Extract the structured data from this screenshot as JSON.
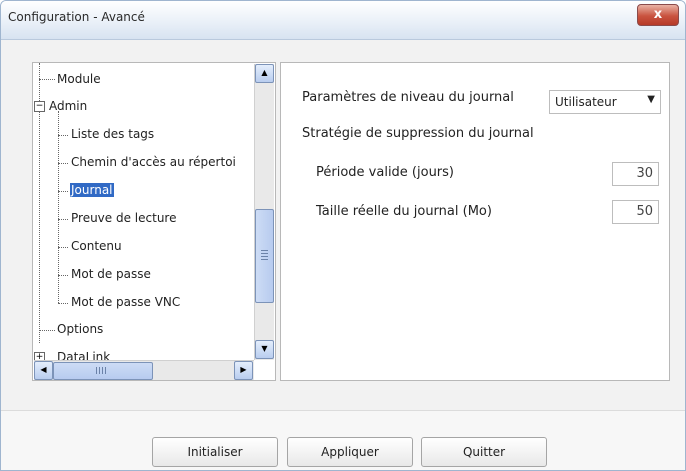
{
  "window": {
    "title": "Configuration - Avancé",
    "close_label": "x"
  },
  "tree": {
    "items": [
      {
        "label": "Module"
      },
      {
        "label": "Admin"
      },
      {
        "label": "Liste des tags"
      },
      {
        "label": "Chemin d'accès au répertoi"
      },
      {
        "label": "Journal"
      },
      {
        "label": "Preuve de lecture"
      },
      {
        "label": "Contenu"
      },
      {
        "label": "Mot de passe"
      },
      {
        "label": "Mot de passe VNC"
      },
      {
        "label": "Options"
      },
      {
        "label": "DataLink"
      }
    ],
    "selected": "Journal"
  },
  "settings": {
    "log_level_label": "Paramètres de niveau du journal",
    "log_level_value": "Utilisateur",
    "deletion_strategy_label": "Stratégie de suppression du journal",
    "valid_period_label": "Période valide (jours)",
    "valid_period_value": "30",
    "log_size_label": "Taille réelle du journal (Mo)",
    "log_size_value": "50"
  },
  "buttons": {
    "reset": "Initialiser",
    "apply": "Appliquer",
    "quit": "Quitter"
  },
  "colors": {
    "selection": "#316ac5",
    "close": "#c9533f"
  }
}
